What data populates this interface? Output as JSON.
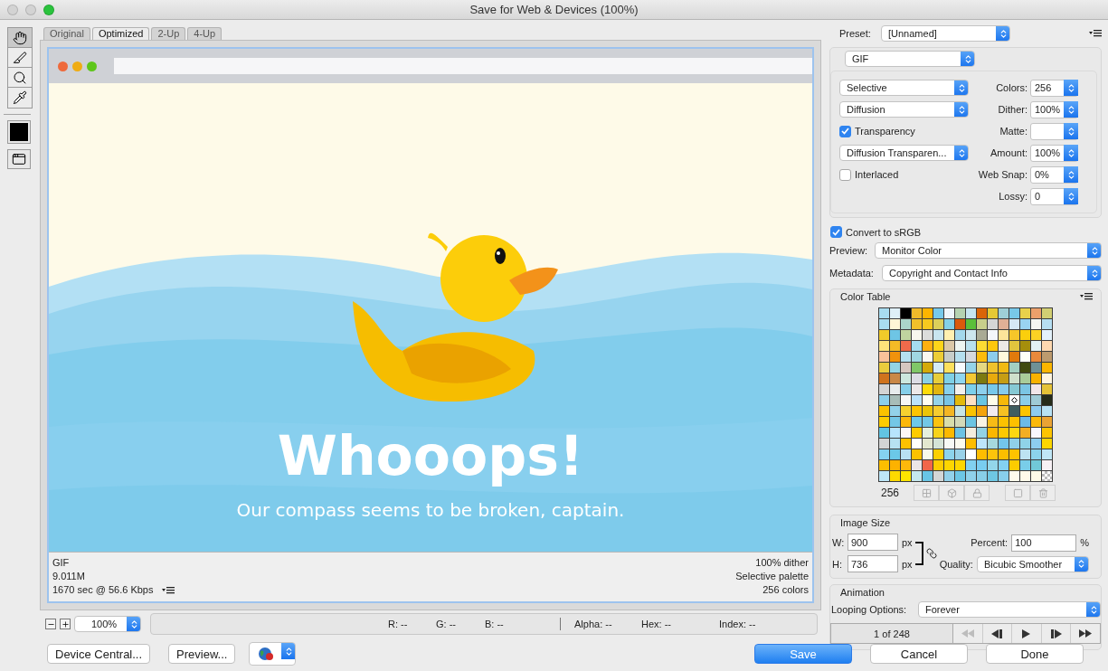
{
  "window": {
    "title": "Save for Web & Devices (100%)"
  },
  "tools": [
    {
      "kind": "hand",
      "selected": true
    },
    {
      "kind": "slice",
      "selected": false
    },
    {
      "kind": "zoom",
      "selected": false
    },
    {
      "kind": "eyedropper",
      "selected": false
    }
  ],
  "view_tabs": [
    {
      "label": "Original",
      "selected": false
    },
    {
      "label": "Optimized",
      "selected": true
    },
    {
      "label": "2-Up",
      "selected": false
    },
    {
      "label": "4-Up",
      "selected": false
    }
  ],
  "preview": {
    "headline": "Whooops!",
    "message": "Our compass seems to be broken, captain.",
    "info_left": [
      "GIF",
      "9.011M",
      "1670 sec @ 56.6 Kbps"
    ],
    "info_right": [
      "100% dither",
      "Selective palette",
      "256 colors"
    ]
  },
  "zoom": {
    "value": "100%"
  },
  "readouts": [
    "R: --",
    "G: --",
    "B: --",
    "Alpha: --",
    "Hex: --",
    "Index: --"
  ],
  "preset": {
    "label": "Preset:",
    "value": "[Unnamed]"
  },
  "format": "GIF",
  "options": [
    {
      "kind": "select",
      "value": "Selective"
    },
    {
      "kind": "select",
      "value": "Diffusion"
    },
    {
      "kind": "checkbox",
      "label": "Transparency",
      "checked": true
    },
    {
      "kind": "select",
      "value": "Diffusion Transparen..."
    },
    {
      "kind": "checkbox",
      "label": "Interlaced",
      "checked": false
    }
  ],
  "fields": [
    {
      "label": "Colors:",
      "value": "256"
    },
    {
      "label": "Dither:",
      "value": "100%"
    },
    {
      "label": "Matte:"
    },
    {
      "label": "Amount:",
      "value": "100%"
    },
    {
      "label": "Web Snap:",
      "value": "0%"
    },
    {
      "label": "Lossy:",
      "value": "0"
    }
  ],
  "convert_srgb": {
    "label": "Convert to sRGB",
    "checked": true
  },
  "preview_mode": {
    "label": "Preview:",
    "value": "Monitor Color"
  },
  "metadata": {
    "label": "Metadata:",
    "value": "Copyright and Contact Info"
  },
  "color_table": {
    "title": "Color Table",
    "count": "256",
    "swatches": [
      {
        "kind": "color",
        "color": "#a8dcef",
        "selected": false
      },
      {
        "kind": "color",
        "color": "#dff0f8",
        "selected": false
      },
      {
        "kind": "color",
        "color": "#000000",
        "selected": false
      },
      {
        "kind": "color",
        "color": "#f0b92a",
        "selected": false
      },
      {
        "kind": "color",
        "color": "#fdb400",
        "selected": false
      },
      {
        "kind": "color",
        "color": "#76c9ea",
        "selected": false
      },
      {
        "kind": "color",
        "color": "#eef5fb",
        "selected": false
      },
      {
        "kind": "color",
        "color": "#b5d2b1",
        "selected": false
      },
      {
        "kind": "color",
        "color": "#c6e4ef",
        "selected": false
      },
      {
        "kind": "color",
        "color": "#da6408",
        "selected": false
      },
      {
        "kind": "color",
        "color": "#e6c935",
        "selected": false
      },
      {
        "kind": "color",
        "color": "#9ecfd6",
        "selected": false
      },
      {
        "kind": "color",
        "color": "#78c8e8",
        "selected": false
      },
      {
        "kind": "color",
        "color": "#e9d14b",
        "selected": false
      },
      {
        "kind": "color",
        "color": "#eba06b",
        "selected": false
      },
      {
        "kind": "color",
        "color": "#d2cf73",
        "selected": false
      },
      {
        "kind": "color",
        "color": "#a9dcef",
        "selected": false
      },
      {
        "kind": "color",
        "color": "#fff6d6",
        "selected": false
      },
      {
        "kind": "color",
        "color": "#aad5ca",
        "selected": false
      },
      {
        "kind": "color",
        "color": "#f1c02a",
        "selected": false
      },
      {
        "kind": "color",
        "color": "#f6c91f",
        "selected": false
      },
      {
        "kind": "color",
        "color": "#dccf5a",
        "selected": false
      },
      {
        "kind": "color",
        "color": "#84d0e6",
        "selected": false
      },
      {
        "kind": "color",
        "color": "#da5a0c",
        "selected": false
      },
      {
        "kind": "color",
        "color": "#5bbf3a",
        "selected": false
      },
      {
        "kind": "color",
        "color": "#c8cf8b",
        "selected": false
      },
      {
        "kind": "color",
        "color": "#d5d6d6",
        "selected": false
      },
      {
        "kind": "color",
        "color": "#dfb096",
        "selected": false
      },
      {
        "kind": "color",
        "color": "#d5e8f5",
        "selected": false
      },
      {
        "kind": "color",
        "color": "#99d3f1",
        "selected": false
      },
      {
        "kind": "color",
        "color": "#f6f7f2",
        "selected": false
      },
      {
        "kind": "color",
        "color": "#b6dff2",
        "selected": false
      },
      {
        "kind": "color",
        "color": "#f1ca2a",
        "selected": false
      },
      {
        "kind": "color",
        "color": "#6ec5e5",
        "selected": false
      },
      {
        "kind": "color",
        "color": "#c0d49f",
        "selected": false
      },
      {
        "kind": "color",
        "color": "#f7f7ee",
        "selected": false
      },
      {
        "kind": "color",
        "color": "#dcdddb",
        "selected": false
      },
      {
        "kind": "color",
        "color": "#c8e5ef",
        "selected": false
      },
      {
        "kind": "color",
        "color": "#fff0b0",
        "selected": false
      },
      {
        "kind": "color",
        "color": "#a3d8ec",
        "selected": false
      },
      {
        "kind": "color",
        "color": "#cce6ef",
        "selected": false
      },
      {
        "kind": "color",
        "color": "#a9aa95",
        "selected": false
      },
      {
        "kind": "color",
        "color": "#f4f7fa",
        "selected": false
      },
      {
        "kind": "color",
        "color": "#fde59a",
        "selected": false
      },
      {
        "kind": "color",
        "color": "#f6c629",
        "selected": false
      },
      {
        "kind": "color",
        "color": "#fbcf0c",
        "selected": false
      },
      {
        "kind": "color",
        "color": "#fbd224",
        "selected": false
      },
      {
        "kind": "color",
        "color": "#e3f1fa",
        "selected": false
      },
      {
        "kind": "color",
        "color": "#fde47a",
        "selected": false
      },
      {
        "kind": "color",
        "color": "#f4bb26",
        "selected": false
      },
      {
        "kind": "color",
        "color": "#f06a4b",
        "selected": false
      },
      {
        "kind": "color",
        "color": "#a5dcef",
        "selected": false
      },
      {
        "kind": "color",
        "color": "#fdb012",
        "selected": false
      },
      {
        "kind": "color",
        "color": "#fdd41a",
        "selected": false
      },
      {
        "kind": "color",
        "color": "#dbc8a8",
        "selected": false
      },
      {
        "kind": "color",
        "color": "#eef5f1",
        "selected": false
      },
      {
        "kind": "color",
        "color": "#b8e0ee",
        "selected": false
      },
      {
        "kind": "color",
        "color": "#fddc33",
        "selected": false
      },
      {
        "kind": "color",
        "color": "#fdc70c",
        "selected": false
      },
      {
        "kind": "color",
        "color": "#ece9e6",
        "selected": false
      },
      {
        "kind": "color",
        "color": "#e1c43e",
        "selected": false
      },
      {
        "kind": "color",
        "color": "#a58e0c",
        "selected": false
      },
      {
        "kind": "color",
        "color": "#e2f1f4",
        "selected": false
      },
      {
        "kind": "color",
        "color": "#fdd8b0",
        "selected": false
      },
      {
        "kind": "color",
        "color": "#fac199",
        "selected": false
      },
      {
        "kind": "color",
        "color": "#f0920c",
        "selected": false
      },
      {
        "kind": "color",
        "color": "#b5e0f1",
        "selected": false
      },
      {
        "kind": "color",
        "color": "#a0d7e2",
        "selected": false
      },
      {
        "kind": "color",
        "color": "#fbf8ef",
        "selected": false
      },
      {
        "kind": "color",
        "color": "#edcd37",
        "selected": false
      },
      {
        "kind": "color",
        "color": "#c7cdca",
        "selected": false
      },
      {
        "kind": "color",
        "color": "#b5dfef",
        "selected": false
      },
      {
        "kind": "color",
        "color": "#d5d8de",
        "selected": false
      },
      {
        "kind": "color",
        "color": "#fcbc0c",
        "selected": false
      },
      {
        "kind": "color",
        "color": "#8dcdec",
        "selected": false
      },
      {
        "kind": "color",
        "color": "#fff9dd",
        "selected": false
      },
      {
        "kind": "color",
        "color": "#e17a0c",
        "selected": false
      },
      {
        "kind": "color",
        "color": "#fefff6",
        "selected": false
      },
      {
        "kind": "color",
        "color": "#e8893c",
        "selected": false
      },
      {
        "kind": "color",
        "color": "#bc9a6e",
        "selected": false
      },
      {
        "kind": "color",
        "color": "#ebcc3d",
        "selected": false
      },
      {
        "kind": "color",
        "color": "#94d4e4",
        "selected": false
      },
      {
        "kind": "color",
        "color": "#d6c7c0",
        "selected": false
      },
      {
        "kind": "color",
        "color": "#80c768",
        "selected": false
      },
      {
        "kind": "color",
        "color": "#d4aa0a",
        "selected": false
      },
      {
        "kind": "color",
        "color": "#d5ebf7",
        "selected": false
      },
      {
        "kind": "color",
        "color": "#fde05c",
        "selected": false
      },
      {
        "kind": "color",
        "color": "#f7fbfd",
        "selected": false
      },
      {
        "kind": "color",
        "color": "#94d3e9",
        "selected": false
      },
      {
        "kind": "color",
        "color": "#e4d882",
        "selected": false
      },
      {
        "kind": "color",
        "color": "#efc22c",
        "selected": false
      },
      {
        "kind": "color",
        "color": "#f1ba12",
        "selected": false
      },
      {
        "kind": "color",
        "color": "#a3cfc1",
        "selected": false
      },
      {
        "kind": "color",
        "color": "#414a10",
        "selected": false
      },
      {
        "kind": "color",
        "color": "#6f9196",
        "selected": false
      },
      {
        "kind": "color",
        "color": "#fcb500",
        "selected": false
      },
      {
        "kind": "color",
        "color": "#d0731d",
        "selected": false
      },
      {
        "kind": "color",
        "color": "#c98847",
        "selected": false
      },
      {
        "kind": "color",
        "color": "#cce7de",
        "selected": false
      },
      {
        "kind": "color",
        "color": "#dcdce4",
        "selected": false
      },
      {
        "kind": "color",
        "color": "#8bd0e4",
        "selected": false
      },
      {
        "kind": "color",
        "color": "#e7cd3a",
        "selected": false
      },
      {
        "kind": "color",
        "color": "#7fd0e6",
        "selected": false
      },
      {
        "kind": "color",
        "color": "#8fd6f0",
        "selected": false
      },
      {
        "kind": "color",
        "color": "#f3c933",
        "selected": false
      },
      {
        "kind": "color",
        "color": "#7d7a10",
        "selected": false
      },
      {
        "kind": "color",
        "color": "#e8aa0d",
        "selected": false
      },
      {
        "kind": "color",
        "color": "#c69d14",
        "selected": false
      },
      {
        "kind": "color",
        "color": "#cedfcb",
        "selected": false
      },
      {
        "kind": "color",
        "color": "#a9cc9a",
        "selected": false
      },
      {
        "kind": "color",
        "color": "#f8b200",
        "selected": false
      },
      {
        "kind": "color",
        "color": "#fff4de",
        "selected": false
      },
      {
        "kind": "color",
        "color": "#d4d4d4",
        "selected": false
      },
      {
        "kind": "color",
        "color": "#e8eced",
        "selected": false
      },
      {
        "kind": "color",
        "color": "#86cfea",
        "selected": false
      },
      {
        "kind": "color",
        "color": "#ece8e8",
        "selected": false
      },
      {
        "kind": "color",
        "color": "#fedb09",
        "selected": false
      },
      {
        "kind": "color",
        "color": "#e3b60f",
        "selected": false
      },
      {
        "kind": "color",
        "color": "#87d0ec",
        "selected": false
      },
      {
        "kind": "color",
        "color": "#f3f0ec",
        "selected": false
      },
      {
        "kind": "color",
        "color": "#7ccfeb",
        "selected": false
      },
      {
        "kind": "color",
        "color": "#8dd0ed",
        "selected": false
      },
      {
        "kind": "color",
        "color": "#77c8eb",
        "selected": false
      },
      {
        "kind": "color",
        "color": "#86cbec",
        "selected": false
      },
      {
        "kind": "color",
        "color": "#86c9d4",
        "selected": false
      },
      {
        "kind": "color",
        "color": "#7bc5e4",
        "selected": false
      },
      {
        "kind": "color",
        "color": "#f1e6e9",
        "selected": false
      },
      {
        "kind": "color",
        "color": "#e5c337",
        "selected": false
      },
      {
        "kind": "color",
        "color": "#8dcfea",
        "selected": false
      },
      {
        "kind": "color",
        "color": "#a8bdb8",
        "selected": false
      },
      {
        "kind": "color",
        "color": "#f7f7f7",
        "selected": false
      },
      {
        "kind": "color",
        "color": "#bbe2fa",
        "selected": false
      },
      {
        "kind": "color",
        "color": "#fffef0",
        "selected": false
      },
      {
        "kind": "color",
        "color": "#94d3ea",
        "selected": false
      },
      {
        "kind": "color",
        "color": "#78c4e6",
        "selected": false
      },
      {
        "kind": "color",
        "color": "#e3ba0b",
        "selected": false
      },
      {
        "kind": "color",
        "color": "#fee0c4",
        "selected": false
      },
      {
        "kind": "color",
        "color": "#6ac5e3",
        "selected": false
      },
      {
        "kind": "color",
        "color": "#fffdea",
        "selected": false
      },
      {
        "kind": "color",
        "color": "#f6b80a",
        "selected": false
      },
      {
        "kind": "color",
        "color": "#ffffff",
        "selected": true
      },
      {
        "kind": "color",
        "color": "#8ccde9",
        "selected": false
      },
      {
        "kind": "color",
        "color": "#9fcbd6",
        "selected": false
      },
      {
        "kind": "color",
        "color": "#252c1a",
        "selected": false
      },
      {
        "kind": "color",
        "color": "#fbc200",
        "selected": false
      },
      {
        "kind": "color",
        "color": "#93d2e9",
        "selected": false
      },
      {
        "kind": "color",
        "color": "#f6d130",
        "selected": false
      },
      {
        "kind": "color",
        "color": "#fcc400",
        "selected": false
      },
      {
        "kind": "color",
        "color": "#ecc408",
        "selected": false
      },
      {
        "kind": "color",
        "color": "#f5cc2f",
        "selected": false
      },
      {
        "kind": "color",
        "color": "#f3b624",
        "selected": false
      },
      {
        "kind": "color",
        "color": "#c6e5e5",
        "selected": false
      },
      {
        "kind": "color",
        "color": "#fbc300",
        "selected": false
      },
      {
        "kind": "color",
        "color": "#f5a30c",
        "selected": false
      },
      {
        "kind": "color",
        "color": "#f3ebef",
        "selected": false
      },
      {
        "kind": "color",
        "color": "#f5c122",
        "selected": false
      },
      {
        "kind": "color",
        "color": "#3f5d60",
        "selected": false
      },
      {
        "kind": "color",
        "color": "#fdc400",
        "selected": false
      },
      {
        "kind": "color",
        "color": "#8dcbf0",
        "selected": false
      },
      {
        "kind": "color",
        "color": "#b8e2f4",
        "selected": false
      },
      {
        "kind": "color",
        "color": "#fdcc01",
        "selected": false
      },
      {
        "kind": "color",
        "color": "#74c7e6",
        "selected": false
      },
      {
        "kind": "color",
        "color": "#fbb80b",
        "selected": false
      },
      {
        "kind": "color",
        "color": "#6dc8e8",
        "selected": false
      },
      {
        "kind": "color",
        "color": "#72c8e6",
        "selected": false
      },
      {
        "kind": "color",
        "color": "#fac310",
        "selected": false
      },
      {
        "kind": "color",
        "color": "#d9deaa",
        "selected": false
      },
      {
        "kind": "color",
        "color": "#d3d9b8",
        "selected": false
      },
      {
        "kind": "color",
        "color": "#6cc5e2",
        "selected": false
      },
      {
        "kind": "color",
        "color": "#f9f3e4",
        "selected": false
      },
      {
        "kind": "color",
        "color": "#f7bb16",
        "selected": false
      },
      {
        "kind": "color",
        "color": "#fbc201",
        "selected": false
      },
      {
        "kind": "color",
        "color": "#fcc000",
        "selected": false
      },
      {
        "kind": "color",
        "color": "#6cbae8",
        "selected": false
      },
      {
        "kind": "color",
        "color": "#fbb90b",
        "selected": false
      },
      {
        "kind": "color",
        "color": "#eaa334",
        "selected": false
      },
      {
        "kind": "color",
        "color": "#62c4e3",
        "selected": false
      },
      {
        "kind": "color",
        "color": "#b7e4fd",
        "selected": false
      },
      {
        "kind": "color",
        "color": "#fdf8f7",
        "selected": false
      },
      {
        "kind": "color",
        "color": "#fdcb00",
        "selected": false
      },
      {
        "kind": "color",
        "color": "#e6f0dc",
        "selected": false
      },
      {
        "kind": "color",
        "color": "#f7d319",
        "selected": false
      },
      {
        "kind": "color",
        "color": "#fbb800",
        "selected": false
      },
      {
        "kind": "color",
        "color": "#6cc3e5",
        "selected": false
      },
      {
        "kind": "color",
        "color": "#f3edde",
        "selected": false
      },
      {
        "kind": "color",
        "color": "#93d2e5",
        "selected": false
      },
      {
        "kind": "color",
        "color": "#fbb700",
        "selected": false
      },
      {
        "kind": "color",
        "color": "#fdc902",
        "selected": false
      },
      {
        "kind": "color",
        "color": "#fdd712",
        "selected": false
      },
      {
        "kind": "color",
        "color": "#f3ae22",
        "selected": false
      },
      {
        "kind": "color",
        "color": "#f8f7fd",
        "selected": false
      },
      {
        "kind": "color",
        "color": "#fdc401",
        "selected": false
      },
      {
        "kind": "color",
        "color": "#d2d4d4",
        "selected": false
      },
      {
        "kind": "color",
        "color": "#b7e2f2",
        "selected": false
      },
      {
        "kind": "color",
        "color": "#fdc100",
        "selected": false
      },
      {
        "kind": "color",
        "color": "#fffffe",
        "selected": false
      },
      {
        "kind": "color",
        "color": "#e3e7cf",
        "selected": false
      },
      {
        "kind": "color",
        "color": "#d4e3d6",
        "selected": false
      },
      {
        "kind": "color",
        "color": "#f7faf5",
        "selected": false
      },
      {
        "kind": "color",
        "color": "#fbfbef",
        "selected": false
      },
      {
        "kind": "color",
        "color": "#fdbd00",
        "selected": false
      },
      {
        "kind": "color",
        "color": "#bde5fb",
        "selected": false
      },
      {
        "kind": "color",
        "color": "#a6d8de",
        "selected": false
      },
      {
        "kind": "color",
        "color": "#73c5ec",
        "selected": false
      },
      {
        "kind": "color",
        "color": "#8fd0e8",
        "selected": false
      },
      {
        "kind": "color",
        "color": "#8fd3e8",
        "selected": false
      },
      {
        "kind": "color",
        "color": "#8dcdef",
        "selected": false
      },
      {
        "kind": "color",
        "color": "#fcd600",
        "selected": false
      },
      {
        "kind": "color",
        "color": "#85d2f0",
        "selected": false
      },
      {
        "kind": "color",
        "color": "#6bc8e8",
        "selected": false
      },
      {
        "kind": "color",
        "color": "#b8e0f2",
        "selected": false
      },
      {
        "kind": "color",
        "color": "#fcc200",
        "selected": false
      },
      {
        "kind": "color",
        "color": "#f8fbea",
        "selected": false
      },
      {
        "kind": "color",
        "color": "#fdd000",
        "selected": false
      },
      {
        "kind": "color",
        "color": "#8cd3ec",
        "selected": false
      },
      {
        "kind": "color",
        "color": "#99d1e8",
        "selected": false
      },
      {
        "kind": "color",
        "color": "#feffff",
        "selected": false
      },
      {
        "kind": "color",
        "color": "#fdbd01",
        "selected": false
      },
      {
        "kind": "color",
        "color": "#fdc40b",
        "selected": false
      },
      {
        "kind": "color",
        "color": "#fcbe00",
        "selected": false
      },
      {
        "kind": "color",
        "color": "#fdc300",
        "selected": false
      },
      {
        "kind": "color",
        "color": "#bde3f2",
        "selected": false
      },
      {
        "kind": "color",
        "color": "#8cd3eb",
        "selected": false
      },
      {
        "kind": "color",
        "color": "#c0e6f5",
        "selected": false
      },
      {
        "kind": "color",
        "color": "#fdbe00",
        "selected": false
      },
      {
        "kind": "color",
        "color": "#fdb200",
        "selected": false
      },
      {
        "kind": "color",
        "color": "#fdb90b",
        "selected": false
      },
      {
        "kind": "color",
        "color": "#ebe5e6",
        "selected": false
      },
      {
        "kind": "color",
        "color": "#f1664a",
        "selected": false
      },
      {
        "kind": "color",
        "color": "#fdcd00",
        "selected": false
      },
      {
        "kind": "color",
        "color": "#fdd600",
        "selected": false
      },
      {
        "kind": "color",
        "color": "#fdd700",
        "selected": false
      },
      {
        "kind": "color",
        "color": "#81d1f0",
        "selected": false
      },
      {
        "kind": "color",
        "color": "#79cdf0",
        "selected": false
      },
      {
        "kind": "color",
        "color": "#93d6ea",
        "selected": false
      },
      {
        "kind": "color",
        "color": "#83d1f0",
        "selected": false
      },
      {
        "kind": "color",
        "color": "#fdcc00",
        "selected": false
      },
      {
        "kind": "color",
        "color": "#79cde9",
        "selected": false
      },
      {
        "kind": "color",
        "color": "#71c9d8",
        "selected": false
      },
      {
        "kind": "color",
        "color": "#f7f1f5",
        "selected": false
      },
      {
        "kind": "color",
        "color": "#bde6f7",
        "selected": false
      },
      {
        "kind": "color",
        "color": "#fdd900",
        "selected": false
      },
      {
        "kind": "color",
        "color": "#fde500",
        "selected": false
      },
      {
        "kind": "color",
        "color": "#c4e8ef",
        "selected": false
      },
      {
        "kind": "color",
        "color": "#68c5e5",
        "selected": false
      },
      {
        "kind": "color",
        "color": "#d3d6d6",
        "selected": false
      },
      {
        "kind": "color",
        "color": "#92d1ea",
        "selected": false
      },
      {
        "kind": "color",
        "color": "#6cc6e5",
        "selected": false
      },
      {
        "kind": "color",
        "color": "#8fd1ea",
        "selected": false
      },
      {
        "kind": "color",
        "color": "#88cfe8",
        "selected": false
      },
      {
        "kind": "color",
        "color": "#6ec7e3",
        "selected": false
      },
      {
        "kind": "color",
        "color": "#88cfec",
        "selected": false
      },
      {
        "kind": "color",
        "color": "#fffbec",
        "selected": false
      },
      {
        "kind": "color",
        "color": "#fffaea",
        "selected": false
      },
      {
        "kind": "color",
        "color": "#fffbe8",
        "selected": false
      },
      {
        "kind": "transparent",
        "selected": false
      }
    ]
  },
  "image_size": {
    "title": "Image Size",
    "width": {
      "label": "W:",
      "value": "900",
      "unit": "px"
    },
    "height": {
      "label": "H:",
      "value": "736",
      "unit": "px"
    },
    "percent": {
      "label": "Percent:",
      "value": "100",
      "unit": "%"
    },
    "quality": {
      "label": "Quality:",
      "value": "Bicubic Smoother"
    }
  },
  "animation": {
    "title": "Animation",
    "looping": {
      "label": "Looping Options:",
      "value": "Forever"
    },
    "frame": "1 of 248",
    "controls": [
      {
        "kind": "first",
        "disabled": true
      },
      {
        "kind": "previous",
        "disabled": false
      },
      {
        "kind": "play",
        "disabled": false
      },
      {
        "kind": "next",
        "disabled": false
      },
      {
        "kind": "last",
        "disabled": false
      }
    ]
  },
  "buttons_left": [
    "Device Central...",
    "Preview..."
  ],
  "buttons_right": [
    {
      "label": "Save",
      "kind": "default"
    },
    {
      "label": "Cancel",
      "kind": "normal"
    },
    {
      "label": "Done",
      "kind": "normal"
    }
  ]
}
